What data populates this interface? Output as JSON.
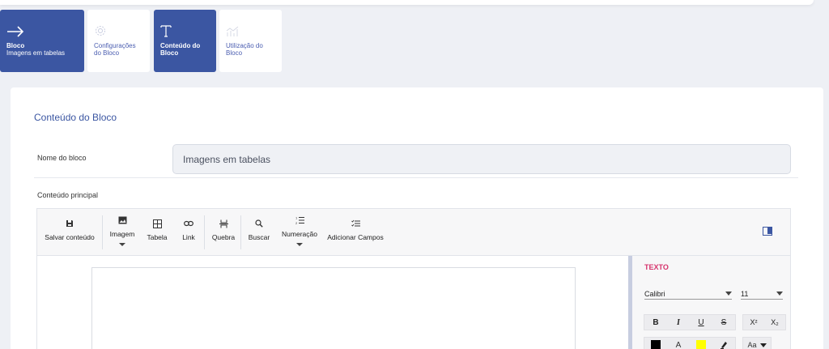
{
  "steps": [
    {
      "title": "Bloco",
      "subtitle": "Imagens em tabelas",
      "icon": "arrow-right-icon",
      "active": true
    },
    {
      "title": "Configurações",
      "subtitle": "do Bloco",
      "icon": "gear-icon",
      "active": false
    },
    {
      "title": "Conteúdo do",
      "subtitle": "Bloco",
      "icon": "text-t-icon",
      "active": true
    },
    {
      "title": "Utilização do",
      "subtitle": "Bloco",
      "icon": "usage-chart-icon",
      "active": false
    }
  ],
  "main": {
    "section_title": "Conteúdo do Bloco",
    "name_label": "Nome do bloco",
    "name_value": "Imagens em tabelas",
    "content_label": "Conteúdo principal"
  },
  "toolbar": {
    "save": "Salvar conteúdo",
    "image": "Imagem",
    "table": "Tabela",
    "link": "Link",
    "break": "Quebra",
    "search": "Buscar",
    "numbering": "Numeração",
    "add_fields": "Adicionar Campos"
  },
  "panel": {
    "title": "TEXTO",
    "font": "Calibri",
    "size": "11",
    "bold": "B",
    "italic": "I",
    "underline": "U",
    "strike": "S",
    "superscript": "X²",
    "subscript": "X₂",
    "font_color_label": "A",
    "case_label": "Aa"
  },
  "colors": {
    "primary": "#3b56a2",
    "accent_pink": "#d6336c",
    "swatch_black": "#000000",
    "swatch_yellow": "#ffff00"
  }
}
